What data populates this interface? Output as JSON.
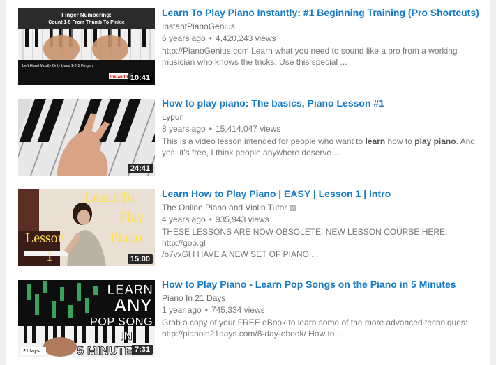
{
  "results": [
    {
      "title": "Learn To Play Piano Instantly: #1 Beginning Training (Pro Shortcuts)",
      "channel": "InstantPianoGenius",
      "age": "6 years ago",
      "views": "4,420,243 views",
      "desc_line1": "http://PianoGenius.com Learn what you need to sound like a pro from a working",
      "desc_line2": "musician who knows the tricks. Use this special ...",
      "duration": "10:41",
      "thumb_text": {
        "line1": "Finger Numbering:",
        "line2": "Count 1-5 From Thumb To Pinkie",
        "footer": "Left Hand Mostly Only Uses 1-2-5 Fingers",
        "logo": "InstantPi"
      }
    },
    {
      "title": "How to play piano: The basics, Piano Lesson #1",
      "channel": "Lypur",
      "age": "8 years ago",
      "views": "15,414,047 views",
      "desc_a": "This is a video lesson intended for people who want to ",
      "desc_b1": "learn",
      "desc_c": " how to ",
      "desc_b2": "play piano",
      "desc_d": ". And",
      "desc_line2": "yes, it's free, I think people anywhere deserve ...",
      "duration": "24:41"
    },
    {
      "title": "Learn How to Play Piano | EASY | Lesson 1 | Intro",
      "channel": "The Online Piano and Violin Tutor",
      "age": "4 years ago",
      "views": "935,943 views",
      "desc_line1": "THESE LESSONS ARE NOW OBSOLETE. NEW LESSON COURSE HERE: http://goo.gl",
      "desc_line2": "/b7vxGl I HAVE A NEW SET OF PIANO ...",
      "duration": "15:00",
      "thumb_text": {
        "learn": "Learn To",
        "play": "Play",
        "piano": "Piano",
        "lesson": "Lesson",
        "num": "1"
      }
    },
    {
      "title": "How to Play Piano - Learn Pop Songs on the Piano in 5 Minutes",
      "channel": "Piano In 21 Days",
      "age": "1 year ago",
      "views": "745,334 views",
      "desc_line1": "Grab a copy of your FREE eBook to learn some of the more advanced techniques:",
      "desc_line2": "http://pianoin21days.com/8-day-ebook/ How to ...",
      "duration": "7:31",
      "thumb_text": {
        "l1": "LEARN",
        "l2": "ANY",
        "l3": "POP SONG",
        "l4": "IN",
        "l5": "5 MINUTE",
        "logo": "21days"
      }
    }
  ],
  "meta_separator": "•"
}
